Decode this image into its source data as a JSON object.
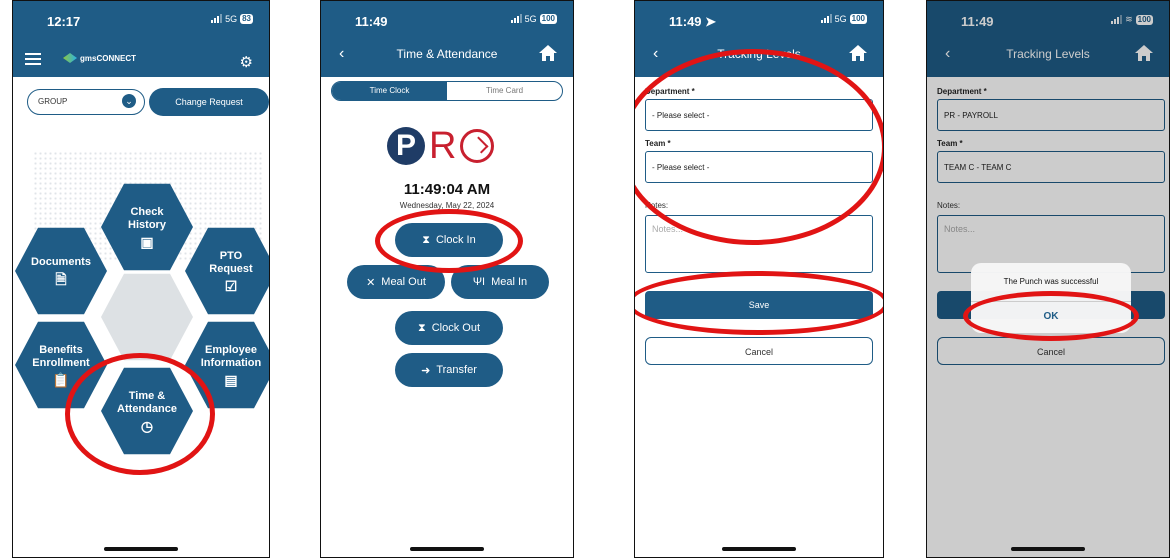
{
  "phone1": {
    "time": "12:17",
    "network": "5G",
    "battery": "83",
    "brand": "gmsCONNECT",
    "group_select": "GROUP",
    "change_request": "Change Request",
    "tiles": {
      "check_history": "Check History",
      "documents": "Documents",
      "pto_request": "PTO Request",
      "benefits_enrollment": "Benefits Enrollment",
      "employee_information": "Employee Information",
      "time_attendance": "Time & Attendance"
    }
  },
  "phone2": {
    "time": "11:49",
    "network": "5G",
    "battery": "100",
    "title": "Time & Attendance",
    "tabs": [
      "Time Clock",
      "Time Card"
    ],
    "logo_letters": [
      "P",
      "R"
    ],
    "clock_time": "11:49:04 AM",
    "date": "Wednesday, May 22, 2024",
    "buttons": {
      "clock_in": "Clock In",
      "meal_out": "Meal Out",
      "meal_in": "Meal In",
      "clock_out": "Clock Out",
      "transfer": "Transfer"
    }
  },
  "phone3": {
    "time": "11:49",
    "network": "5G",
    "battery": "100",
    "title": "Tracking Levels",
    "department_label": "Department *",
    "department_value": "- Please select -",
    "team_label": "Team *",
    "team_value": "- Please select -",
    "notes_label": "Notes:",
    "notes_placeholder": "Notes...",
    "save": "Save",
    "cancel": "Cancel"
  },
  "phone4": {
    "time": "11:49",
    "battery": "100",
    "title": "Tracking Levels",
    "department_label": "Department *",
    "department_value": "PR - PAYROLL",
    "team_label": "Team *",
    "team_value": "TEAM C - TEAM C",
    "notes_label": "Notes:",
    "notes_placeholder": "Notes...",
    "cancel": "Cancel",
    "alert_message": "The Punch was successful",
    "alert_ok": "OK"
  },
  "colors": {
    "brand": "#1f5c86",
    "highlight": "#e11414",
    "pro_red": "#c8202f",
    "pro_navy": "#1f3c66"
  }
}
